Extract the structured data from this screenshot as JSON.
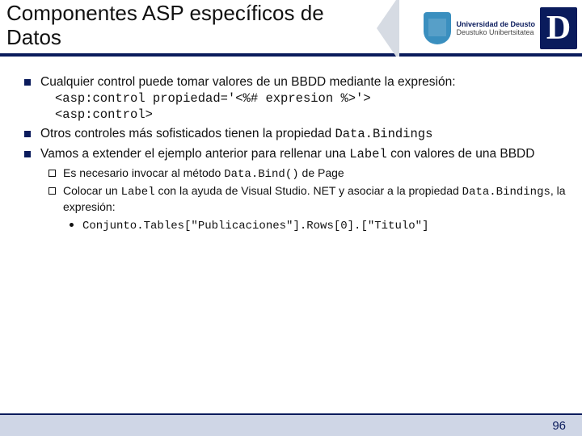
{
  "title_line1": "Componentes ASP específicos de",
  "title_line2": "Datos",
  "university": {
    "es": "Universidad de Deusto",
    "eu": "Deustuko Unibertsitatea",
    "letter": "D"
  },
  "bullets": {
    "b1_text": "Cualquier control puede tomar valores de un BBDD mediante la expresión:",
    "b1_code1": "<asp:control propiedad='<%# expresion %>'>",
    "b1_code2": "<asp:control>",
    "b2_pre": "Otros controles más sofisticados tienen la propiedad ",
    "b2_code": "Data.Bindings",
    "b3_pre": "Vamos a extender el ejemplo anterior para rellenar una ",
    "b3_code": "Label",
    "b3_post": " con valores de una BBDD",
    "sub1_pre": "Es necesario invocar al método ",
    "sub1_code": "Data.Bind()",
    "sub1_post": " de Page",
    "sub2_pre": "Colocar un ",
    "sub2_code1": "Label",
    "sub2_mid": " con la ayuda de Visual Studio. NET y asociar a la propiedad ",
    "sub2_code2": "Data.Bindings",
    "sub2_post": ", la expresión:",
    "subsub_code": "Conjunto.Tables[\"Publicaciones\"].Rows[0].[\"Titulo\"]"
  },
  "page_number": "96"
}
